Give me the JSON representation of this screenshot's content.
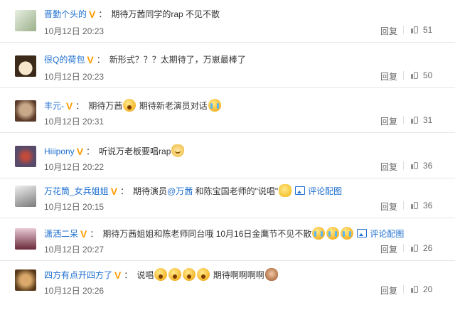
{
  "accent_color": "#1e6fd0",
  "badge_color": "#ff9b00",
  "reply_label": "回复",
  "comments": [
    {
      "username": "晋勤个头的",
      "badge": "V",
      "text": "期待万茜同学的rap 不见不散",
      "time": "10月12日 20:23",
      "likes": "51",
      "avatar_colors": [
        "#e8efe2",
        "#9bb08a"
      ]
    },
    {
      "username": "很Q的荷包",
      "badge": "V",
      "text": "新形式？？？太期待了，万崽最棒了",
      "time": "10月12日 20:23",
      "likes": "50",
      "avatar_colors": [
        "#f5e6cc",
        "#3b2a1a"
      ]
    },
    {
      "username": "丰元-",
      "badge": "V",
      "text_a": "期待万茜",
      "text_b": "期待新老演员对话",
      "time": "10月12日 20:31",
      "likes": "31",
      "avatar_colors": [
        "#c9a88a",
        "#5a3a28"
      ]
    },
    {
      "username": "Hiiipony",
      "badge": "V",
      "text": "听说万老板要唱rap",
      "time": "10月12日 20:22",
      "likes": "36",
      "avatar_colors": [
        "#5a4a6a",
        "#c24a3a"
      ]
    },
    {
      "username": "万花筒_女兵姐姐",
      "badge": "V",
      "text_a": "期待演员",
      "mention": "@万茜",
      "text_b": "和陈宝国老师的\"说唱\"",
      "pic_link": "评论配图",
      "time": "10月12日 20:15",
      "likes": "36",
      "avatar_colors": [
        "#e6e6e6",
        "#7a7a7a"
      ]
    },
    {
      "username": "潇洒二呆",
      "badge": "V",
      "text": "期待万茜姐姐和陈老师同台哦 10月16日金鹰节不见不散",
      "pic_link": "评论配图",
      "time": "10月12日 20:27",
      "likes": "26",
      "avatar_colors": [
        "#e9c9d6",
        "#6a2a3a"
      ]
    },
    {
      "username": "四方有点开四方了",
      "badge": "V",
      "text_a": "说唱",
      "text_b": "期待啊啊啊啊",
      "time": "10月12日 20:26",
      "likes": "20",
      "avatar_colors": [
        "#d9a86a",
        "#5a3a1a"
      ]
    }
  ]
}
